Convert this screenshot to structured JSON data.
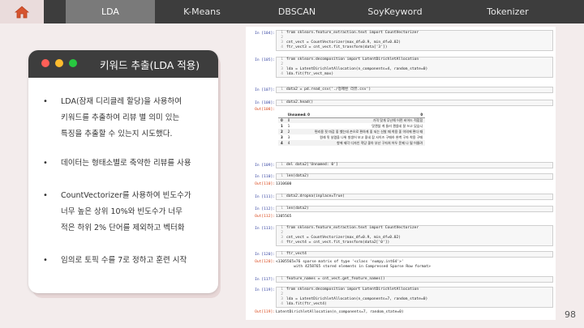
{
  "nav": {
    "home_icon": "home-icon",
    "tabs": [
      {
        "label": "LDA",
        "active": true
      },
      {
        "label": "K-Means",
        "active": false
      },
      {
        "label": "DBSCAN",
        "active": false
      },
      {
        "label": "SoyKeyword",
        "active": false
      },
      {
        "label": "Tokenizer",
        "active": false
      }
    ]
  },
  "card": {
    "title": "키워드 추출(LDA 적용)",
    "dots": [
      "#ff5f57",
      "#febc2e",
      "#28c840"
    ],
    "bullets": [
      " LDA(잠재 디리클레 할당)을 사용하여\n키워드를 추출하여 리뷰 별 의미 있는\n특징을 추출할 수 있는지 시도했다.",
      "데이터는 형태소별로 축약한 리뷰를 사용",
      " CountVectorizer를 사용하여 빈도수가\n너무 높은 상위 10%와 빈도수가 너무\n적은 하위 2% 단어를 제외하고 벡터화",
      "임의로 토픽 수를 7로 정하고 훈련 시작"
    ]
  },
  "notebook": {
    "cells": [
      {
        "prompt": "In [104]:",
        "lines": [
          "from sklearn.feature_extraction.text import CountVectorizer",
          "",
          "cnt_vect = CountVectorizer(max_df=0.9, min_df=0.02)",
          "ftr_vect3 = cnt_vect.fit_transform(data['3'])"
        ]
      },
      {
        "prompt": "In [105]:",
        "lines": [
          "from sklearn.decomposition import LatentDirichletAllocation",
          "",
          "lda = LatentDirichletAllocation(n_components=4, random_state=0)",
          "lda.fit(ftr_vect_max)"
        ]
      },
      {
        "prompt": "In [107]:",
        "lines": [
          "data2 = pd.read_csv('./정제된 리뷰.csv')"
        ]
      },
      {
        "prompt": "In [108]:",
        "lines": [
          "data2.head()"
        ]
      },
      {
        "prompt": "In [109]:",
        "lines": [
          "del data2['Unnamed: 0']"
        ]
      },
      {
        "prompt": "In [110]:",
        "lines": [
          "len(data2)"
        ]
      },
      {
        "prompt": "In [111]:",
        "lines": [
          "data2.dropna(inplace=True)"
        ]
      },
      {
        "prompt": "In [112]:",
        "lines": [
          "len(data2)"
        ]
      },
      {
        "prompt": "In [113]:",
        "lines": [
          "from sklearn.feature_extraction.text import CountVectorizer",
          "",
          "cnt_vect = CountVectorizer(max_df=0.9, min_df=0.02)",
          "ftr_vect4 = cnt_vect.fit_transform(data2['0'])"
        ]
      },
      {
        "prompt": "In [120]:",
        "lines": [
          "ftr_vect4"
        ]
      },
      {
        "prompt": "In [117]:",
        "lines": [
          "feature_names = cnt_vect.get_feature_names()"
        ]
      },
      {
        "prompt": "In [119]:",
        "lines": [
          "from sklearn.decomposition import LatentDirichletAllocation",
          "",
          "lda = LatentDirichletAllocation(n_components=7, random_state=0)",
          "lda.fit(ftr_vect4)"
        ]
      }
    ],
    "outputs": [
      {
        "prompt": "Out[108]:",
        "text": ""
      },
      {
        "prompt": "Out[110]:",
        "text": "1310600"
      },
      {
        "prompt": "Out[112]:",
        "text": "1305565"
      },
      {
        "prompt": "Out[120]:",
        "text": "<1305565x76 sparse matrix of type '<class 'numpy.int64'>'\n        with 4258765 stored elements in Compressed Sparse Row format>"
      },
      {
        "prompt": "Out[119]:",
        "text": "LatentDirichletAllocation(n_components=7, random_state=0)"
      }
    ],
    "dataframe": {
      "columns": [
        "",
        "Unnamed: 0",
        "0"
      ],
      "rows": [
        [
          "0",
          "0",
          "가격 맛개 무난해 어떤 비어드 적합합"
        ],
        [
          "1",
          "1",
          "맛괜찮 게 들러 괜찮네 잘 쓰고 있습니"
        ],
        [
          "2",
          "2",
          "편리용 핏 마감 좋 했는데 손으로 편하게 좋 되는 신발 때 착용 좋 이의에 편다 때"
        ],
        [
          "3",
          "3",
          "원래 핏 날렸을 나위 발생어 보고 좋네 잡 사이즈 구매하 완벽 구자 착용 구매"
        ],
        [
          "4",
          "4",
          "항에 제각 디자인 적당 좋아 부난 구자처 어두 문제 나 될 어울려"
        ]
      ]
    }
  },
  "page_number": "98"
}
